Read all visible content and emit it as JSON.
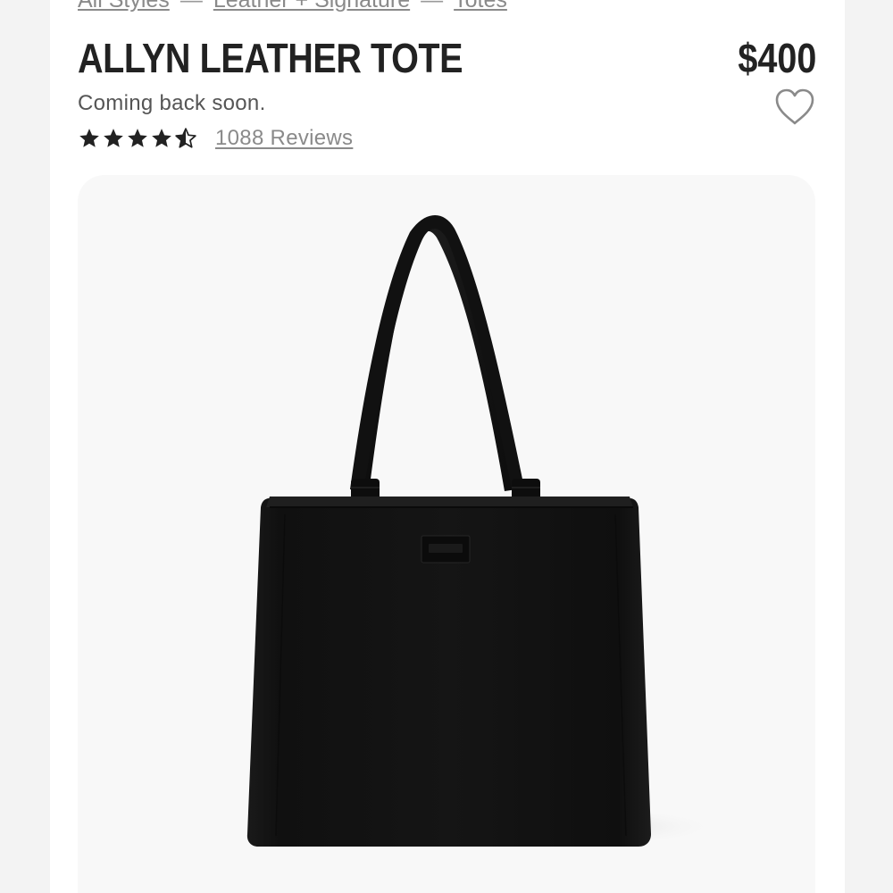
{
  "breadcrumb": {
    "items": [
      "All Styles",
      "Leather + Signature",
      "Totes"
    ],
    "separator": "—"
  },
  "product": {
    "title": "ALLYN LEATHER TOTE",
    "price": "$400",
    "status": "Coming back soon.",
    "rating": 4.5,
    "rating_max": 5,
    "reviews_label": "1088 Reviews",
    "bag_color": "#101010"
  },
  "icons": {
    "wishlist": "heart-outline-icon",
    "star_full": "star-filled-icon",
    "star_half": "star-half-icon"
  },
  "colors": {
    "text_primary": "#222222",
    "text_muted": "#8a8a8a",
    "card_bg": "#f8f8f8"
  }
}
